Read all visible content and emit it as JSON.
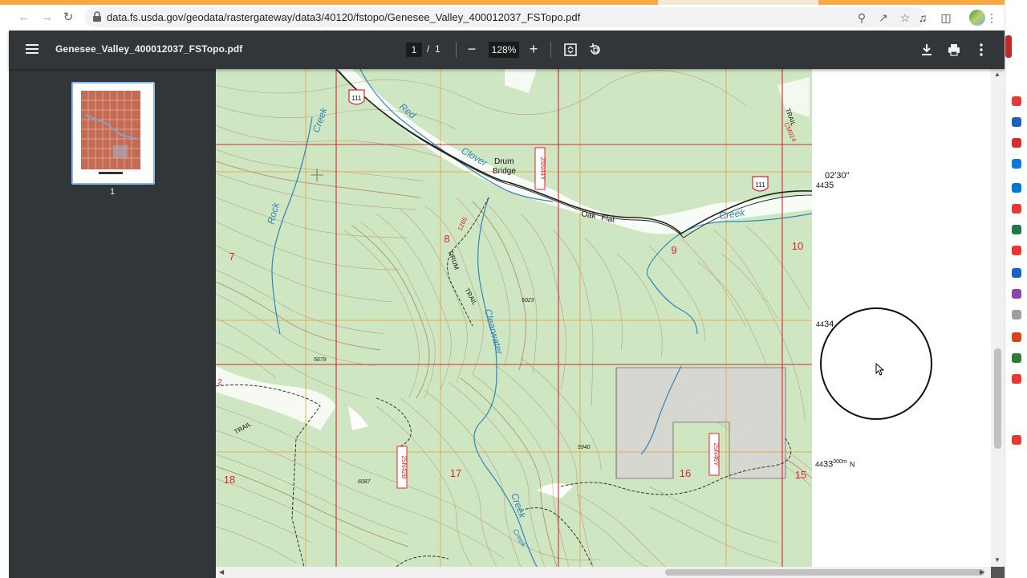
{
  "browser": {
    "url": "data.fs.usda.gov/geodata/rastergateway/data3/40120/fstopo/Genesee_Valley_400012037_FSTopo.pdf",
    "icons": [
      "back-icon",
      "forward-icon",
      "reload-icon",
      "lock-icon",
      "zoom-icon",
      "share-icon",
      "star-icon",
      "media-icon",
      "side-panel-icon",
      "profile-avatar",
      "kebab-menu-icon"
    ],
    "accent_color": "#f6a945"
  },
  "pdf_toolbar": {
    "title": "Genesee_Valley_400012037_FSTopo.pdf",
    "page_current": "1",
    "page_separator": "/",
    "page_total": "1",
    "zoom": "128%",
    "icons": [
      "menu-icon",
      "zoom-out-icon",
      "zoom-in-icon",
      "fit-page-icon",
      "rotate-icon",
      "download-icon",
      "print-icon",
      "more-icon"
    ],
    "background": "#323639"
  },
  "sidebar": {
    "thumbnail_label": "1",
    "background": "#323639"
  },
  "map": {
    "sections": [
      "7",
      "8",
      "9",
      "10",
      "16",
      "17",
      "18",
      "15",
      "2"
    ],
    "place_names": [
      "Drum",
      "Bridge",
      "Oak",
      "Flat"
    ],
    "water_labels": [
      "Red",
      "Clover",
      "Creek",
      "Rock",
      "Creek",
      "Creek",
      "Clearwater",
      "Creek"
    ],
    "trail_labels": [
      "DRUM",
      "TRAIL",
      "TRAIL",
      "TRAIL"
    ],
    "route_shields": [
      "111",
      "111"
    ],
    "road_ids": [
      "25N44Y",
      "25N42B",
      "25N46Y",
      "1265",
      "CM024"
    ],
    "elevations": [
      "5023",
      "5679",
      "5940",
      "6087"
    ],
    "colors": {
      "vegetation": "#cfe6c2",
      "contour": "#b38a5e",
      "water": "#2f86b8",
      "section_line": "#d8262e",
      "grid_line": "#e8a23b",
      "private_land": "#d8d6d4"
    }
  },
  "map_margin": {
    "minutes_label": "02′30″",
    "northing_1_prefix": "44",
    "northing_1_main": "35",
    "northing_2_prefix": "44",
    "northing_2_main": "34",
    "northing_3_prefix": "44",
    "northing_3_main": "33",
    "northing_3_suffix": "000m",
    "northing_3_dir": "N"
  }
}
